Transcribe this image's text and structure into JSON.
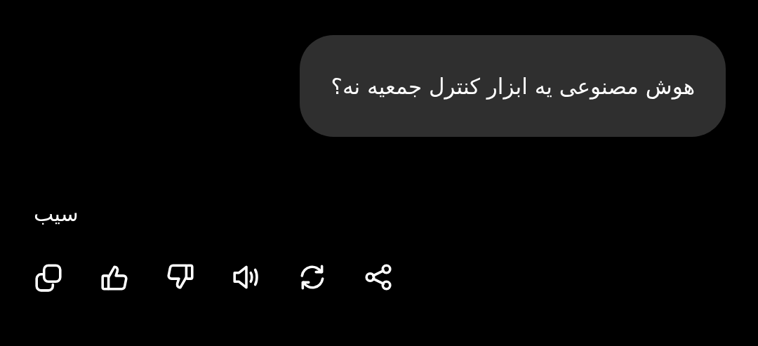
{
  "user_message": {
    "text": "هوش مصنوعی یه ابزار کنترل جمعیه نه؟"
  },
  "reply": {
    "text": "سیب"
  },
  "actions": [
    {
      "kind": "copy"
    },
    {
      "kind": "like"
    },
    {
      "kind": "dislike"
    },
    {
      "kind": "speak"
    },
    {
      "kind": "regenerate"
    },
    {
      "kind": "share"
    }
  ]
}
